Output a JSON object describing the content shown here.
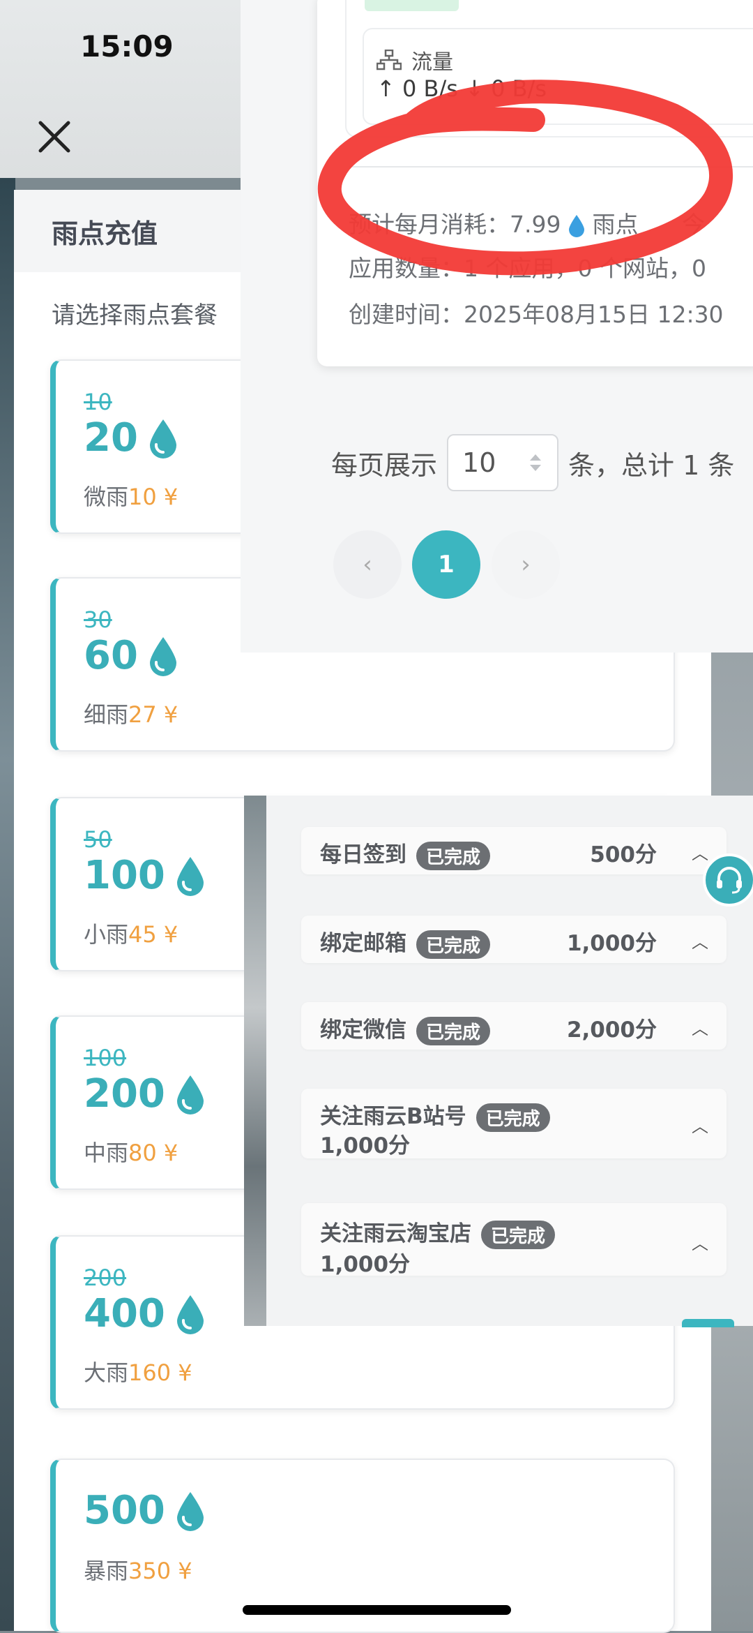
{
  "status_bar": {
    "time": "15:09"
  },
  "recharge": {
    "title": "雨点充值",
    "subtitle": "请选择雨点套餐",
    "currency": "¥",
    "packages": [
      {
        "original": "10",
        "amount": "20",
        "name": "微雨",
        "price": "10"
      },
      {
        "original": "30",
        "amount": "60",
        "name": "细雨",
        "price": "27"
      },
      {
        "original": "50",
        "amount": "100",
        "name": "小雨",
        "price": "45"
      },
      {
        "original": "100",
        "amount": "200",
        "name": "中雨",
        "price": "80"
      },
      {
        "original": "200",
        "amount": "400",
        "name": "大雨",
        "price": "160"
      },
      {
        "original": "",
        "amount": "500",
        "name": "暴雨",
        "price": "350"
      }
    ]
  },
  "server_card": {
    "flow_label": "流量",
    "flow_rate": "↑ 0 B/s ↓ 0 B/s",
    "monthly_cost_label": "预计每月消耗：",
    "monthly_cost_value": "7.99",
    "monthly_cost_unit": "雨点",
    "monthly_cost_tail": "今",
    "app_count": "应用数量：1 个应用，0 个网站，0",
    "created": "创建时间：2025年08月15日 12:30"
  },
  "pagination": {
    "per_page_label": "每页展示",
    "per_page_value": "10",
    "total_text": "条，总计 1 条",
    "current_page": "1",
    "prev_symbol": "‹",
    "next_symbol": "›"
  },
  "tasks": [
    {
      "name": "每日签到",
      "status": "已完成",
      "points": "500分"
    },
    {
      "name": "绑定邮箱",
      "status": "已完成",
      "points": "1,000分"
    },
    {
      "name": "绑定微信",
      "status": "已完成",
      "points": "2,000分"
    },
    {
      "name": "关注雨云B站号",
      "status": "已完成",
      "points": "1,000分"
    },
    {
      "name": "关注雨云淘宝店",
      "status": "已完成",
      "points": "1,000分"
    }
  ],
  "colors": {
    "accent": "#3cb6c0",
    "price": "#f0a040",
    "highlight_scribble": "#f23a36"
  }
}
